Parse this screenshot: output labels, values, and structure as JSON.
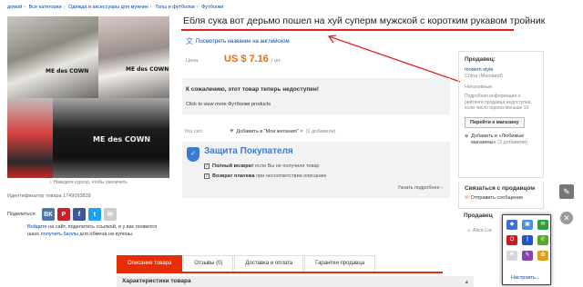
{
  "breadcrumb": [
    "домой",
    "Все категории",
    "Одежда и аксессуары для мужчин",
    "Топы и футболки",
    "Футболки"
  ],
  "breadcrumb_sep": "›",
  "gallery": {
    "zoom_hint": "Наведите курсор, чтобы увеличить",
    "tee_text": "ME des COWN"
  },
  "product": {
    "title": "Ебля сука вот дерьмо пошел на хуй суперм мужской с коротким рукавом тройник",
    "translate_link": "Посмотреть название на английском",
    "price_label": "Цена:",
    "price": "US $ 7.16",
    "unit": "/ шт.",
    "id_text": "Идентификатор товара 1749093839",
    "unavailable": "К сожалению, этот товар теперь недоступен!",
    "similar_link": "Click to view more Футболки products",
    "wish_label": "You can:",
    "wish_link": "Добавить в \"Мои желания\"",
    "wish_count": "(1 добавили)"
  },
  "protection": {
    "title": "Защита Покупателя",
    "row1_bold": "Полный возврат",
    "row1_rest": " если Вы не получили товар",
    "row2_bold": "Возврат платежа",
    "row2_rest": " при несоответствии описанию",
    "more": "Узнать подробнее ›"
  },
  "share": {
    "label": "Поделиться:",
    "buttons": [
      "ВК",
      "P",
      "f",
      "t",
      "✉"
    ],
    "invite_a": "Войдите",
    "invite_b": " на сайт, поделитесь ссылкой, и у вас появится шанс ",
    "invite_c": "получить баллы",
    "invite_d": " для обмена на купоны."
  },
  "seller": {
    "label": "Продавец:",
    "name": "modern style",
    "country": "China (Mainland)",
    "rating": "Негативные",
    "info": "Подробная информация о рейтинге продавца недоступна, если число оценок меньше 10.",
    "store_button": "Перейти к магазину",
    "fav": "Добавить в «Любимые магазины»",
    "fav_count": "(3 добавили)"
  },
  "contact": {
    "label": "Связаться с продавцом",
    "send": "Отправить сообщение"
  },
  "sold_label": "Продавец",
  "alice_label": "Alice Lia",
  "popup": {
    "settings": "Настроить...",
    "icons": [
      {
        "name": "shield-ext-icon",
        "color": "#3b6fd4",
        "glyph": "◆"
      },
      {
        "name": "photo-ext-icon",
        "color": "#4a90d9",
        "glyph": "▣"
      },
      {
        "name": "chat-ext-icon",
        "color": "#2e9e3a",
        "glyph": "✉"
      },
      {
        "name": "opera-ext-icon",
        "color": "#cc1c1c",
        "glyph": "O"
      },
      {
        "name": "bluetooth-ext-icon",
        "color": "#2255cc",
        "glyph": "ᛒ"
      },
      {
        "name": "phone-ext-icon",
        "color": "#55aa22",
        "glyph": "✆"
      },
      {
        "name": "flag-ext-icon",
        "color": "#d7d7d7",
        "glyph": "⚑"
      },
      {
        "name": "pen-ext-icon",
        "color": "#8844aa",
        "glyph": "✎"
      },
      {
        "name": "gear-ext-icon",
        "color": "#e0a020",
        "glyph": "✿"
      }
    ]
  },
  "tabs": [
    "Описание товара",
    "Отзывы (0)",
    "Доставка и оплата",
    "Гарантии продавца"
  ],
  "specs_label": "Характеристики товара",
  "colors": {
    "accent": "#e62e04",
    "price": "#ff6600",
    "link": "#0645ad",
    "protect": "#3a7bd5"
  }
}
